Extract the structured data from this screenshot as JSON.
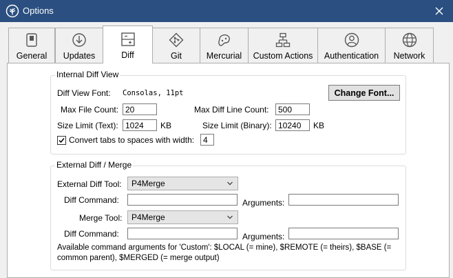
{
  "window": {
    "title": "Options"
  },
  "tabs": [
    {
      "label": "General",
      "icon": "switch-icon"
    },
    {
      "label": "Updates",
      "icon": "download-circle-icon"
    },
    {
      "label": "Diff",
      "icon": "diff-icon"
    },
    {
      "label": "Git",
      "icon": "git-icon"
    },
    {
      "label": "Mercurial",
      "icon": "mercurial-icon"
    },
    {
      "label": "Custom Actions",
      "icon": "flowchart-icon"
    },
    {
      "label": "Authentication",
      "icon": "user-icon"
    },
    {
      "label": "Network",
      "icon": "globe-icon"
    }
  ],
  "selected_tab": "Diff",
  "internal": {
    "title": "Internal Diff View",
    "font_label": "Diff View Font:",
    "font_value": "Consolas, 11pt",
    "change_font": "Change Font...",
    "max_file_count_label": "Max File Count:",
    "max_file_count": "20",
    "max_line_label": "Max Diff Line Count:",
    "max_line": "500",
    "size_text_label": "Size Limit (Text):",
    "size_text": "1024",
    "size_text_unit": "KB",
    "size_bin_label": "Size Limit (Binary):",
    "size_bin": "10240",
    "size_bin_unit": "KB",
    "convert_label": "Convert tabs to spaces with width:",
    "convert_checked": true,
    "tab_width": "4"
  },
  "external": {
    "title": "External Diff / Merge",
    "diff_tool_label": "External Diff Tool:",
    "diff_tool": "P4Merge",
    "diff_cmd_label": "Diff Command:",
    "diff_cmd": "",
    "diff_args_label": "Arguments:",
    "diff_args": "",
    "merge_tool_label": "Merge Tool:",
    "merge_tool": "P4Merge",
    "merge_cmd_label": "Diff Command:",
    "merge_cmd": "",
    "merge_args_label": "Arguments:",
    "merge_args": "",
    "note": "Available command arguments for 'Custom': $LOCAL (= mine), $REMOTE (= theirs), $BASE (= common parent), $MERGED (= merge output)"
  }
}
